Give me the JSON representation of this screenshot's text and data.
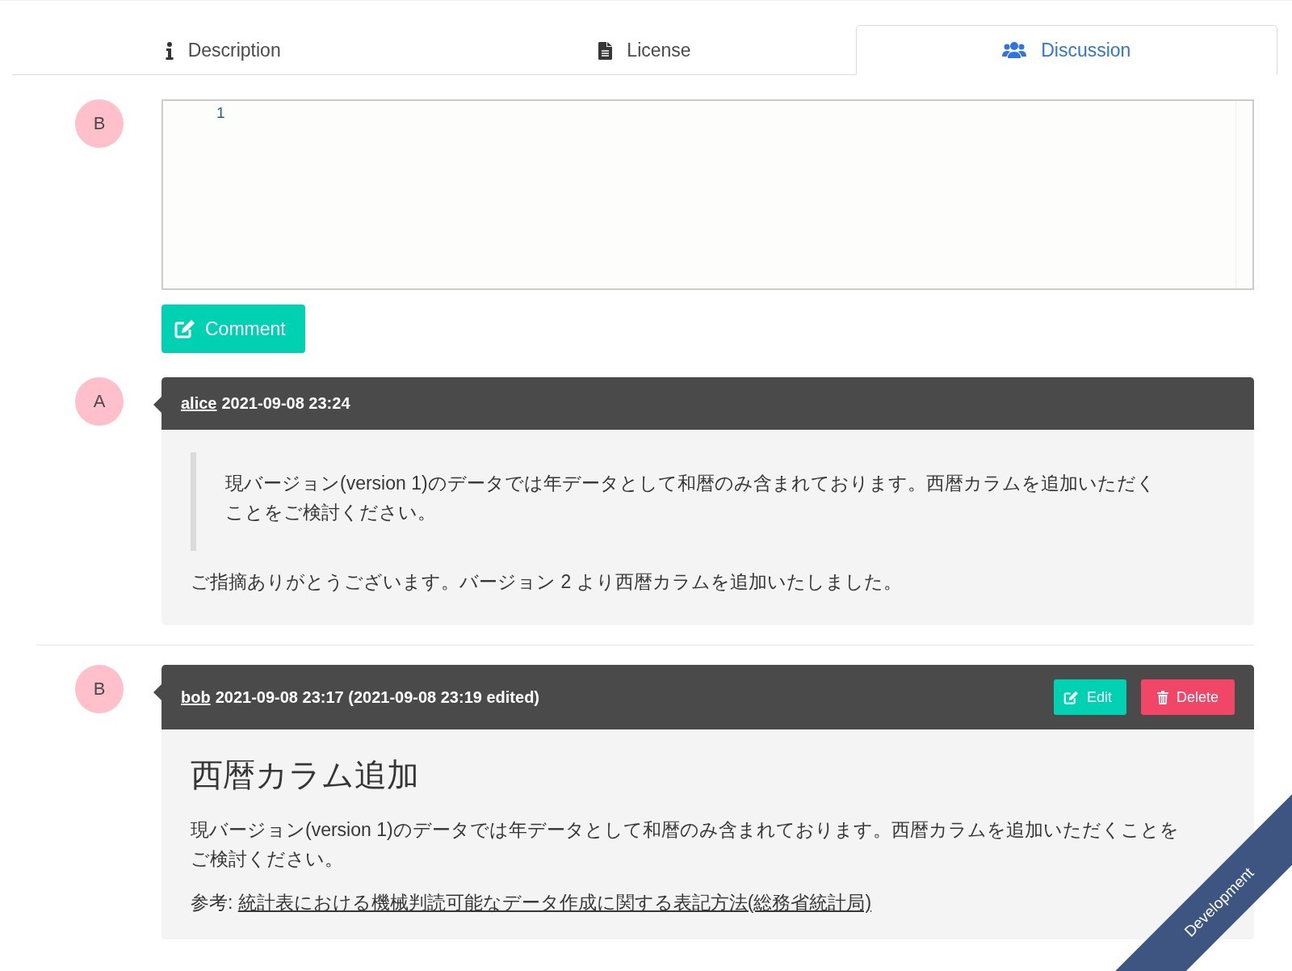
{
  "tabs": [
    {
      "label": "Description",
      "selected": false
    },
    {
      "label": "License",
      "selected": false
    },
    {
      "label": "Discussion",
      "selected": true
    }
  ],
  "composer": {
    "avatar": "B",
    "line_number": "1",
    "button": "Comment"
  },
  "comments": [
    {
      "avatar": "A",
      "author": "alice",
      "meta": "2021-09-08 23:24",
      "blocks": [
        {
          "kind": "quote",
          "text": "現バージョン(version 1)のデータでは年データとして和暦のみ含まれております。西暦カラムを追加いただくことをご検討ください。"
        },
        {
          "kind": "paragraph",
          "text": "ご指摘ありがとうございます。バージョン 2 より西暦カラムを追加いたしました。"
        }
      ]
    },
    {
      "avatar": "B",
      "author": "bob",
      "meta": "2021-09-08 23:17 (2021-09-08 23:19 edited)",
      "buttons": [
        {
          "kind": "edit",
          "label": "Edit"
        },
        {
          "kind": "delete",
          "label": "Delete"
        }
      ],
      "blocks": [
        {
          "kind": "heading",
          "text": "西暦カラム追加"
        },
        {
          "kind": "paragraph",
          "text": "現バージョン(version 1)のデータでは年データとして和暦のみ含まれております。西暦カラムを追加いただくことをご検討ください。"
        },
        {
          "kind": "reference",
          "prefix": "参考:",
          "link": "統計表における機械判読可能なデータ作成に関する表記方法(総務省統計局)"
        }
      ]
    }
  ],
  "ribbon": "Development"
}
